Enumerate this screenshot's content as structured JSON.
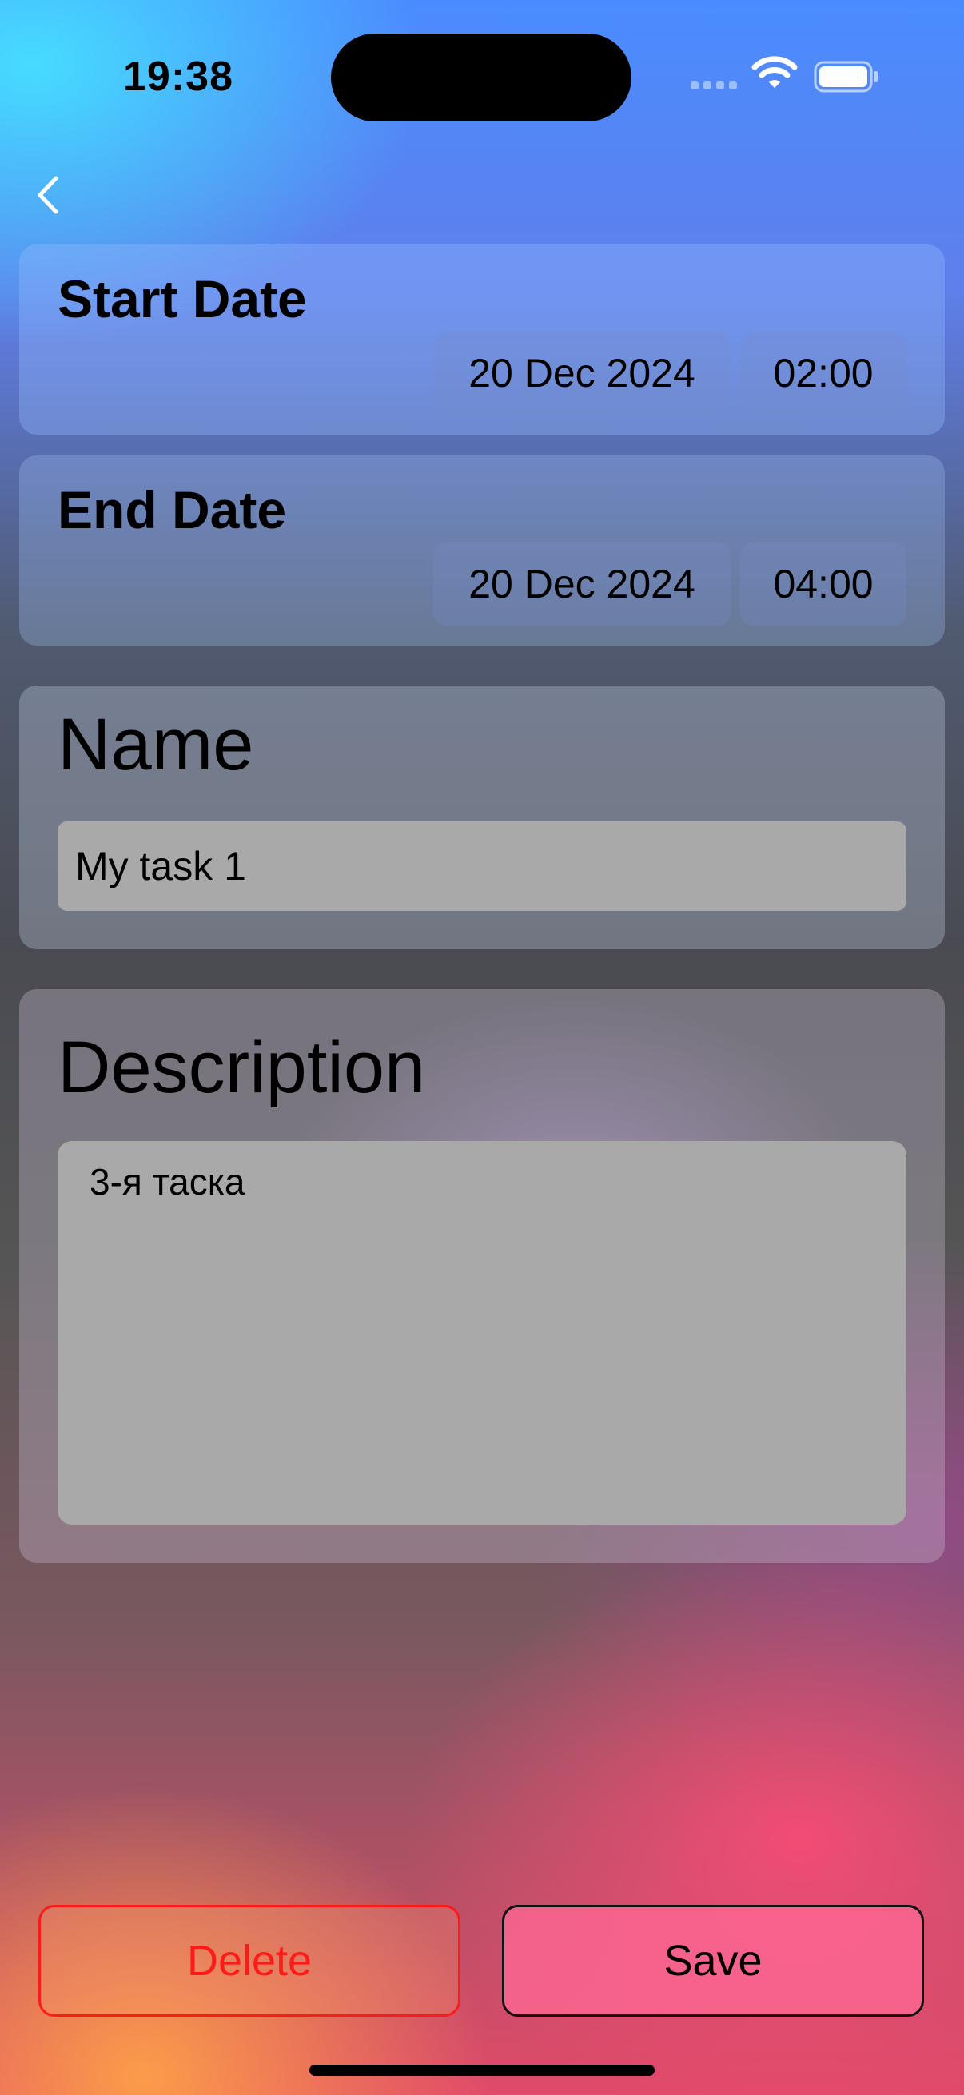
{
  "status_bar": {
    "time": "19:38",
    "icons": [
      "cellular-signal-icon",
      "wifi-icon",
      "battery-icon"
    ]
  },
  "nav": {
    "back_icon": "chevron-left-icon"
  },
  "start_date": {
    "label": "Start Date",
    "date": "20 Dec 2024",
    "time": "02:00"
  },
  "end_date": {
    "label": "End Date",
    "date": "20 Dec 2024",
    "time": "04:00"
  },
  "name": {
    "label": "Name",
    "value": "My task 1"
  },
  "description": {
    "label": "Description",
    "value": "3-я таска"
  },
  "actions": {
    "delete_label": "Delete",
    "save_label": "Save"
  },
  "colors": {
    "delete": "#ff1a1a",
    "save_fill": "#ff6a96",
    "input_fill": "#a9a9a9"
  }
}
